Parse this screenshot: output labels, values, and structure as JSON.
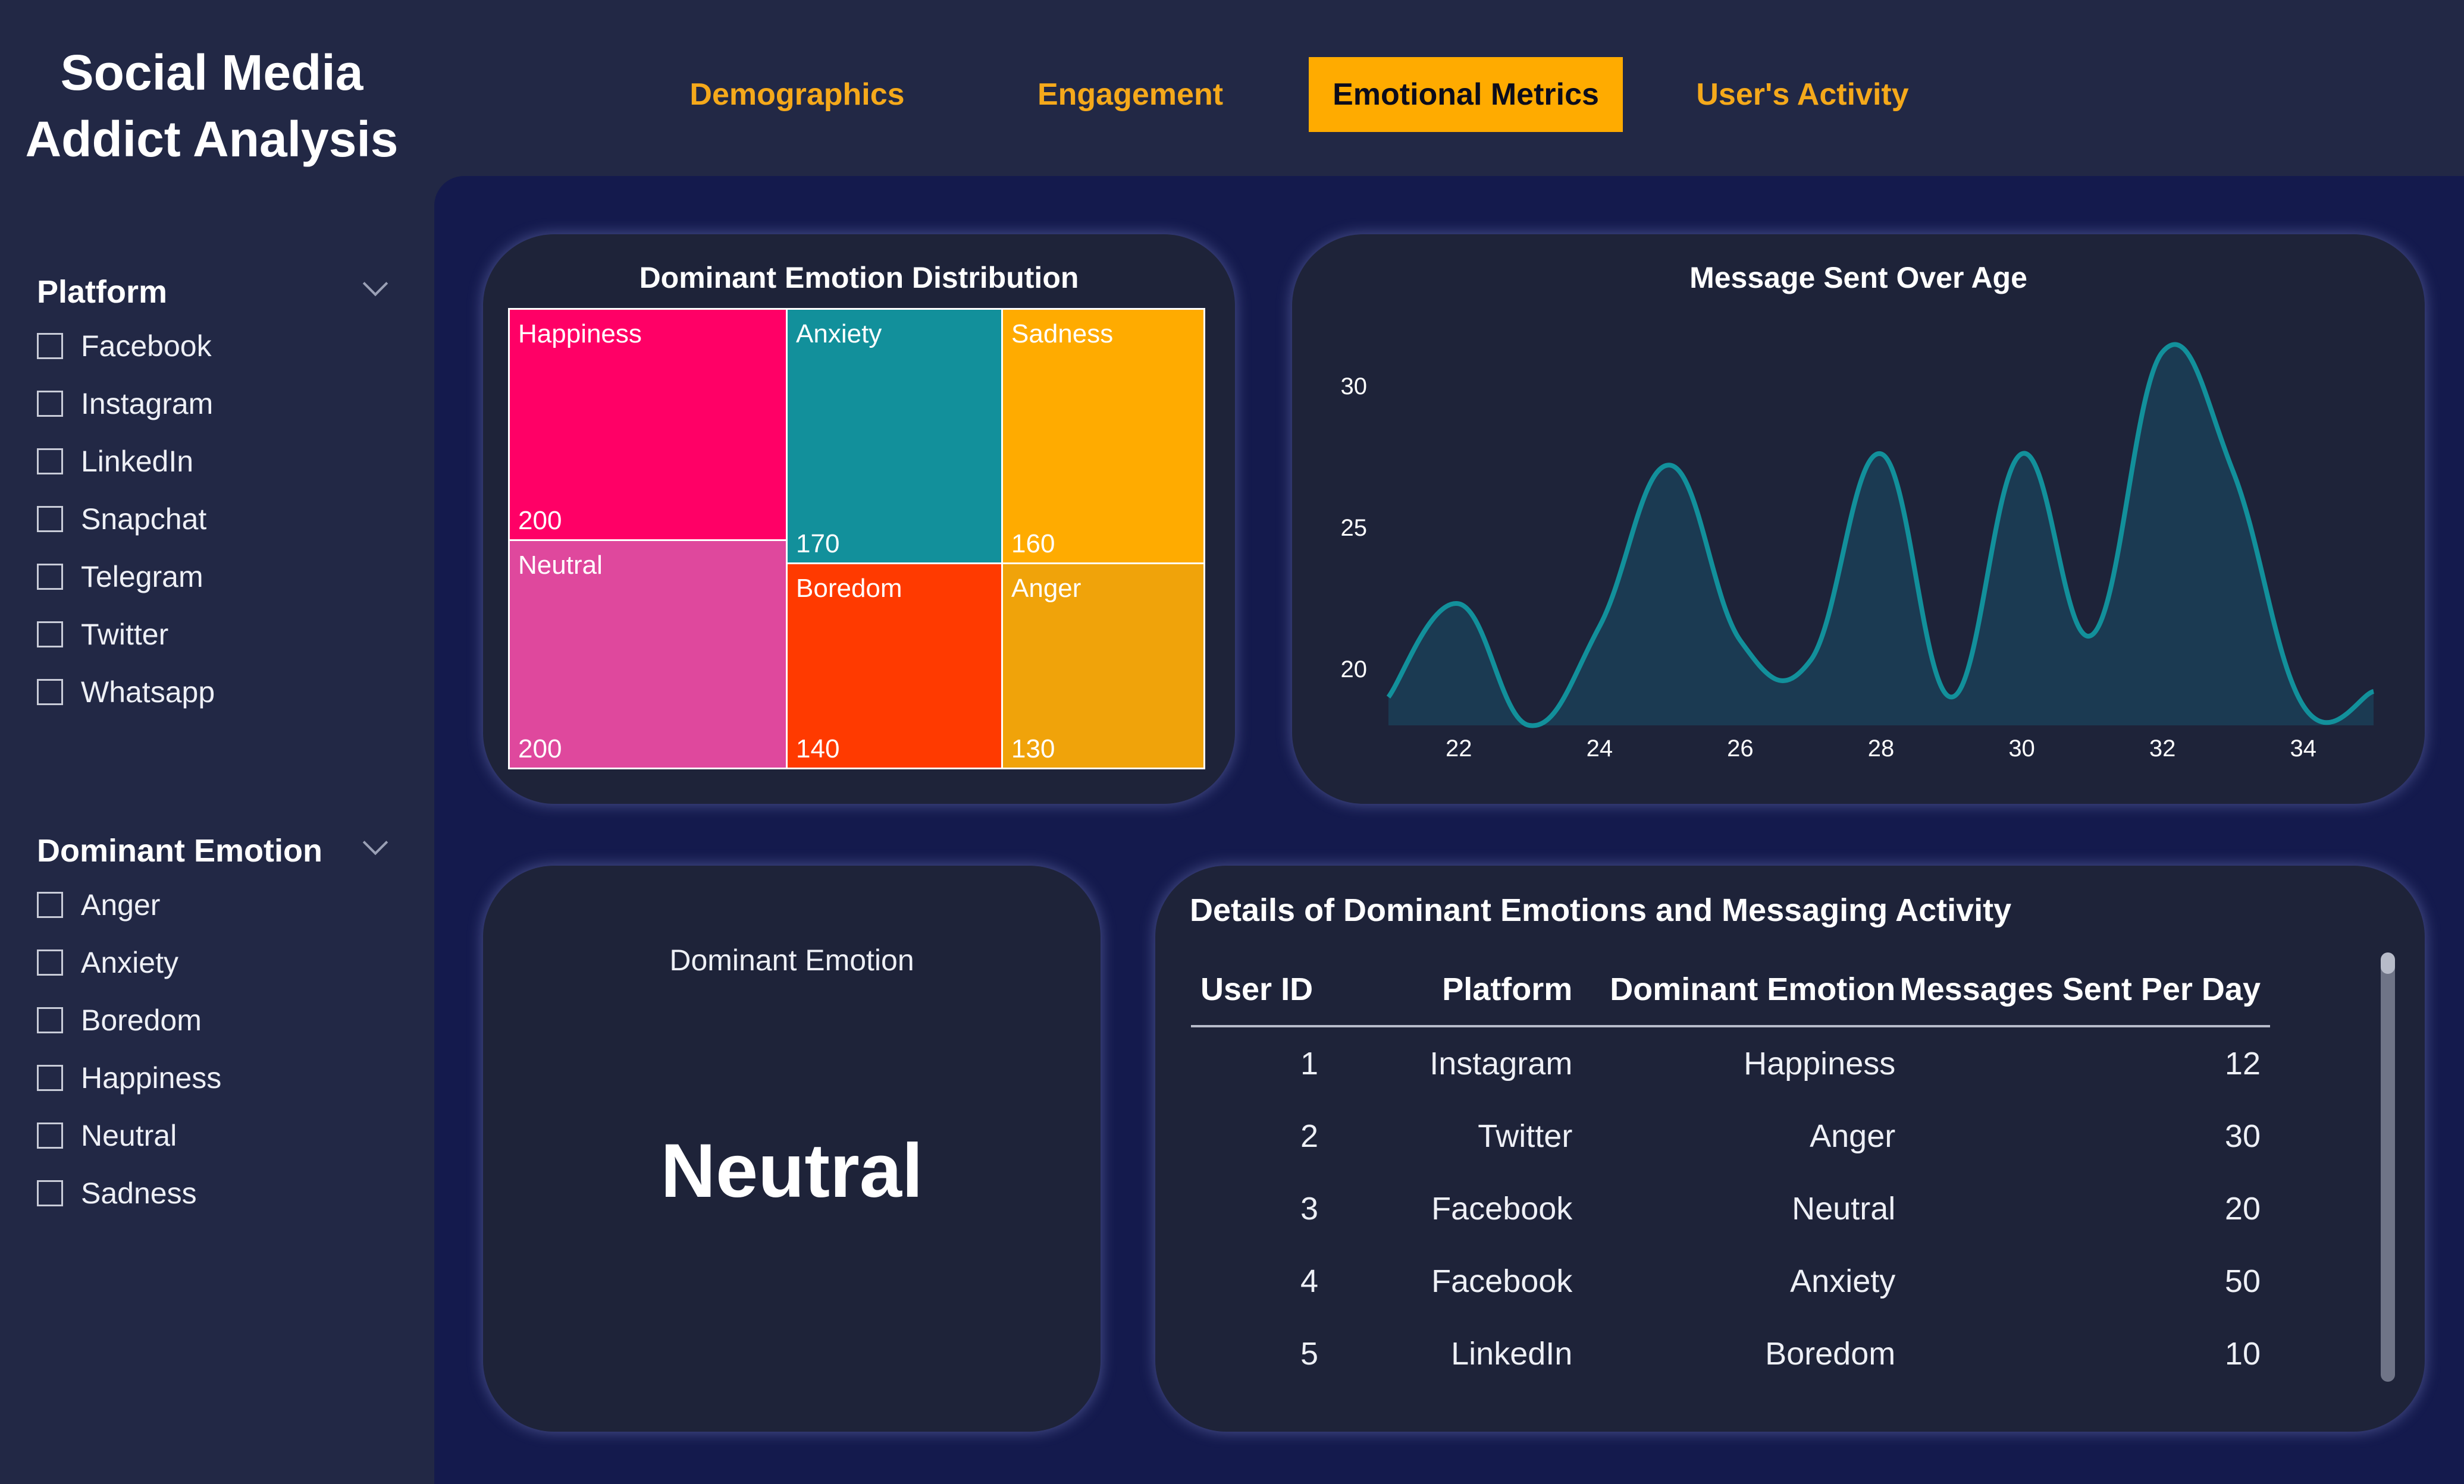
{
  "app": {
    "title": "Social Media\nAddict Analysis"
  },
  "nav": {
    "tabs": [
      {
        "label": "Demographics",
        "active": false
      },
      {
        "label": "Engagement",
        "active": false
      },
      {
        "label": "Emotional Metrics",
        "active": true
      },
      {
        "label": "User's Activity",
        "active": false
      }
    ]
  },
  "filters": {
    "platform": {
      "title": "Platform",
      "options": [
        "Facebook",
        "Instagram",
        "LinkedIn",
        "Snapchat",
        "Telegram",
        "Twitter",
        "Whatsapp"
      ]
    },
    "emotion": {
      "title": "Dominant Emotion",
      "options": [
        "Anger",
        "Anxiety",
        "Boredom",
        "Happiness",
        "Neutral",
        "Sadness"
      ]
    }
  },
  "treemap": {
    "title": "Dominant Emotion Distribution",
    "items": [
      {
        "label": "Happiness",
        "value": "200",
        "color": "#ff0066"
      },
      {
        "label": "Neutral",
        "value": "200",
        "color": "#df489d"
      },
      {
        "label": "Anxiety",
        "value": "170",
        "color": "#12909b"
      },
      {
        "label": "Boredom",
        "value": "140",
        "color": "#ff3a00"
      },
      {
        "label": "Sadness",
        "value": "160",
        "color": "#ffab00"
      },
      {
        "label": "Anger",
        "value": "130",
        "color": "#f0a30a"
      }
    ]
  },
  "chart_data": {
    "type": "area",
    "title": "Message Sent Over Age",
    "xlabel": "",
    "ylabel": "",
    "x": [
      21,
      22,
      23,
      24,
      25,
      26,
      27,
      28,
      29,
      30,
      31,
      32,
      33,
      34,
      35
    ],
    "values": [
      19,
      22.3,
      18,
      21.5,
      27.2,
      21,
      20.3,
      27.6,
      19,
      27.6,
      21.2,
      31.2,
      27,
      18.7,
      19.2
    ],
    "xticks": [
      "22",
      "24",
      "26",
      "28",
      "30",
      "32",
      "34"
    ],
    "yticks": [
      "30",
      "25",
      "20"
    ],
    "xlim": [
      21,
      35
    ],
    "ylim": [
      18,
      32
    ],
    "line_color": "#12909b",
    "fill_color": "#1b3a52",
    "grid": false
  },
  "card": {
    "label": "Dominant Emotion",
    "value": "Neutral"
  },
  "details": {
    "title": "Details of Dominant Emotions and Messaging Activity",
    "columns": [
      "User ID",
      "Platform",
      "Dominant Emotion",
      "Messages Sent Per Day"
    ],
    "rows": [
      [
        "1",
        "Instagram",
        "Happiness",
        "12"
      ],
      [
        "2",
        "Twitter",
        "Anger",
        "30"
      ],
      [
        "3",
        "Facebook",
        "Neutral",
        "20"
      ],
      [
        "4",
        "Facebook",
        "Anxiety",
        "50"
      ],
      [
        "5",
        "LinkedIn",
        "Boredom",
        "10"
      ]
    ]
  }
}
